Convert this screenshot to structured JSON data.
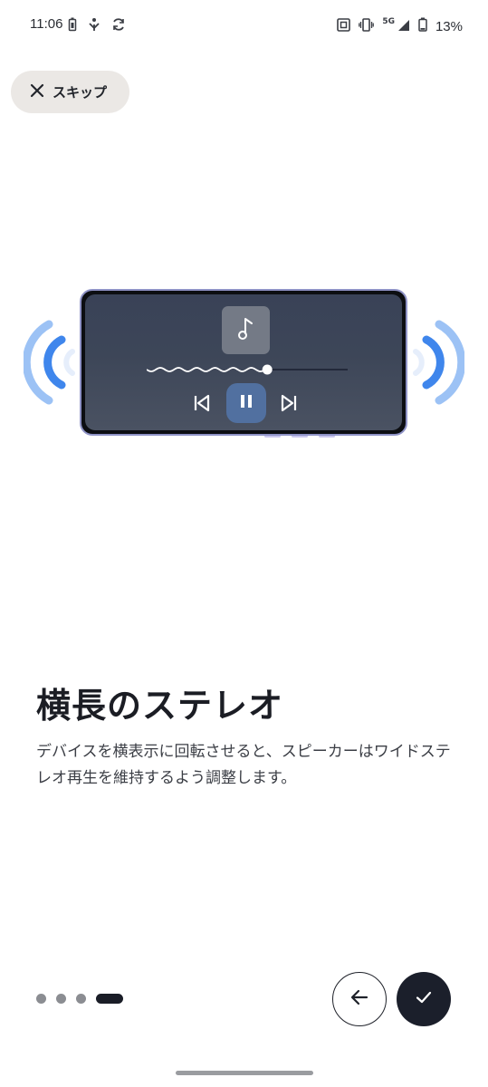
{
  "status_bar": {
    "time": "11:06",
    "battery_percent": "13%",
    "network": "5G",
    "left_icons": [
      "battery-saver-icon",
      "accessibility-icon",
      "sync-icon"
    ],
    "right_icons": [
      "nfc-icon",
      "vibrate-icon",
      "signal-icon",
      "battery-icon"
    ]
  },
  "skip": {
    "label": "スキップ",
    "icon": "close-icon"
  },
  "illustration": {
    "icons": [
      "music-note-icon",
      "previous-icon",
      "pause-icon",
      "next-icon",
      "left-speaker-waves-icon",
      "right-speaker-waves-icon"
    ],
    "seek_progress": 0.6,
    "accent_color": "#4a8ff0"
  },
  "content": {
    "title": "横長のステレオ",
    "description": "デバイスを横表示に回転させると、スピーカーはワイドステレオ再生を維持するよう調整します。"
  },
  "pager": {
    "total": 4,
    "current": 4
  },
  "navigation": {
    "back_icon": "arrow-left-icon",
    "done_icon": "check-icon"
  },
  "colors": {
    "primary_dark": "#1b1f2b",
    "skip_bg": "#ebe8e5",
    "waves_light": "#9cc2f5",
    "waves_dark": "#3f86ec"
  }
}
